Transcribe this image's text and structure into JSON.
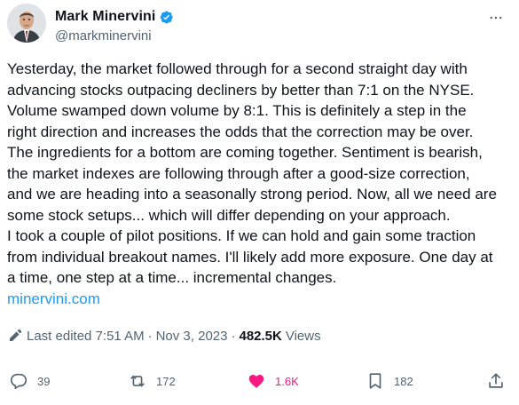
{
  "author": {
    "display_name": "Mark Minervini",
    "handle": "@markminervini"
  },
  "tweet": {
    "lines": [
      "Yesterday, the market followed through for a second straight day with",
      "advancing stocks outpacing decliners by better than 7:1 on the NYSE.",
      "Volume swamped down volume by 8:1. This is definitely a step in the",
      "right direction and increases the odds that the correction may be over.",
      "The ingredients for a bottom are coming together. Sentiment is bearish,",
      "the market indexes are following through after a good-size correction,",
      "and we are heading into a seasonally strong period. Now, all we need are",
      "some stock setups... which will differ depending on your approach.",
      "I took a couple of pilot positions. If we can hold and gain some traction",
      "from individual breakout names. I'll likely add more exposure. One day at",
      "a time, one step at a time...  incremental changes."
    ],
    "link": "minervini.com"
  },
  "meta": {
    "edited": "Last edited 7:51 AM",
    "date": "Nov 3, 2023",
    "views_count": "482.5K",
    "views_label": "Views",
    "separator": "·"
  },
  "actions": {
    "replies": "39",
    "reposts": "172",
    "likes": "1.6K",
    "bookmarks": "182"
  },
  "colors": {
    "text": "#0f1419",
    "secondary": "#536471",
    "link": "#1d9bf0",
    "like": "#f91880",
    "verified": "#1d9bf0"
  },
  "icons": [
    "verified-badge-icon",
    "more-icon",
    "pencil-icon",
    "reply-icon",
    "repost-icon",
    "heart-icon",
    "bookmark-icon",
    "share-icon"
  ]
}
